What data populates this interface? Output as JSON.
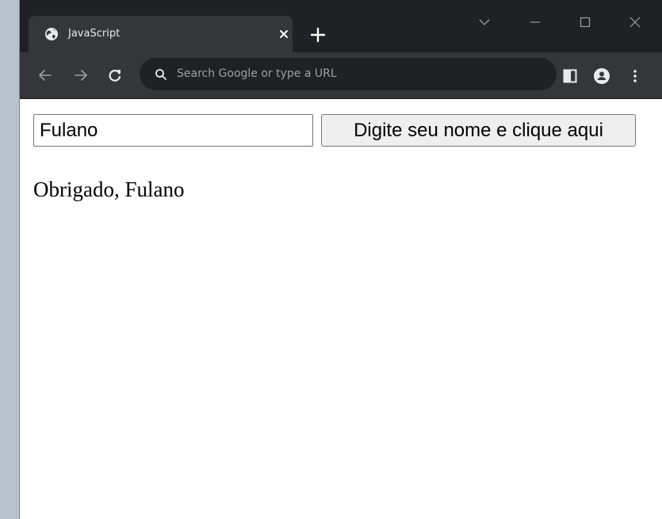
{
  "browser": {
    "tab": {
      "title": "JavaScript",
      "favicon": "globe-icon"
    },
    "omnibox": {
      "placeholder": "Search Google or type a URL"
    },
    "icons": {
      "back": "back-arrow-icon",
      "forward": "forward-arrow-icon",
      "reload": "reload-icon",
      "side_panel": "side-panel-icon",
      "profile": "profile-icon",
      "menu": "kebab-menu-icon",
      "new_tab": "plus-icon",
      "tab_search": "chevron-down-icon",
      "minimize": "minimize-icon",
      "maximize": "maximize-icon",
      "close": "close-icon"
    },
    "colors": {
      "frame": "#202124",
      "toolbar": "#35363a",
      "omnibox": "#202124",
      "icon": "#e8eaed"
    }
  },
  "page": {
    "name_input": {
      "value": "Fulano"
    },
    "submit_button": {
      "label": "Digite seu nome e clique aqui"
    },
    "thanks_message": "Obrigado, Fulano"
  }
}
